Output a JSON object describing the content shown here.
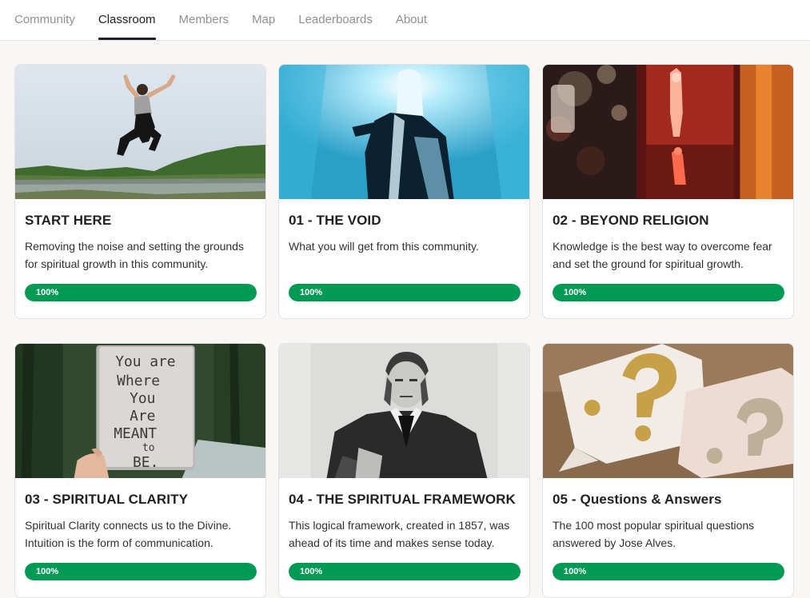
{
  "nav": {
    "tabs": [
      {
        "label": "Community",
        "active": false
      },
      {
        "label": "Classroom",
        "active": true
      },
      {
        "label": "Members",
        "active": false
      },
      {
        "label": "Map",
        "active": false
      },
      {
        "label": "Leaderboards",
        "active": false
      },
      {
        "label": "About",
        "active": false
      }
    ]
  },
  "courses": [
    {
      "title": "START HERE",
      "description": "Removing the noise and setting the grounds for spiritual growth in this community.",
      "progress_label": "100%",
      "progress": 1.0
    },
    {
      "title": "01 - THE VOID",
      "description": "What you will get from this community.",
      "progress_label": "100%",
      "progress": 1.0
    },
    {
      "title": "02 - BEYOND RELIGION",
      "description": "Knowledge is the best way to overcome fear and set the ground for spiritual growth.",
      "progress_label": "100%",
      "progress": 1.0
    },
    {
      "title": "03 - SPIRITUAL CLARITY",
      "description": "Spiritual Clarity connects us to the Divine. Intuition is the form of communication.",
      "progress_label": "100%",
      "progress": 1.0,
      "image_text": [
        "You are",
        "Where",
        "You",
        "Are",
        "MEANT",
        "to",
        "BE."
      ]
    },
    {
      "title": "04 - THE SPIRITUAL FRAMEWORK",
      "description": "This logical framework, created in 1857, was ahead of its time and makes sense today.",
      "progress_label": "100%",
      "progress": 1.0
    },
    {
      "title": "05 - Questions & Answers",
      "description": "The 100 most popular spiritual questions answered by Jose Alves.",
      "progress_label": "100%",
      "progress": 1.0
    }
  ],
  "colors": {
    "progress_fill": "#019a55",
    "active_tab": "#202124",
    "inactive_tab": "#909090"
  }
}
